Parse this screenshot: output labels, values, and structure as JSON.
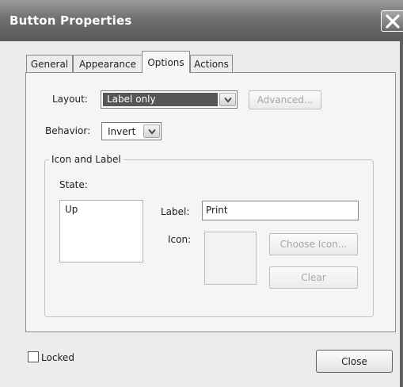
{
  "window": {
    "title": "Button Properties"
  },
  "tabs": [
    {
      "label": "General"
    },
    {
      "label": "Appearance"
    },
    {
      "label": "Options",
      "active": true
    },
    {
      "label": "Actions"
    }
  ],
  "options": {
    "layout_label": "Layout:",
    "layout_value": "Label only",
    "advanced_button": "Advanced...",
    "behavior_label": "Behavior:",
    "behavior_value": "Invert",
    "group_title": "Icon and Label",
    "state_label": "State:",
    "state_items": [
      "Up"
    ],
    "label_field_label": "Label:",
    "label_field_value": "Print",
    "icon_label": "Icon:",
    "choose_icon_button": "Choose Icon...",
    "clear_button": "Clear"
  },
  "footer": {
    "locked_label": "Locked",
    "locked_checked": false,
    "close_button": "Close"
  },
  "colors": {
    "title_bar": "#6f6f6f",
    "dialog_bg": "#ececec",
    "selection": "#555555"
  },
  "icons": {
    "close": "close-icon",
    "dropdown": "chevron-down-icon"
  }
}
